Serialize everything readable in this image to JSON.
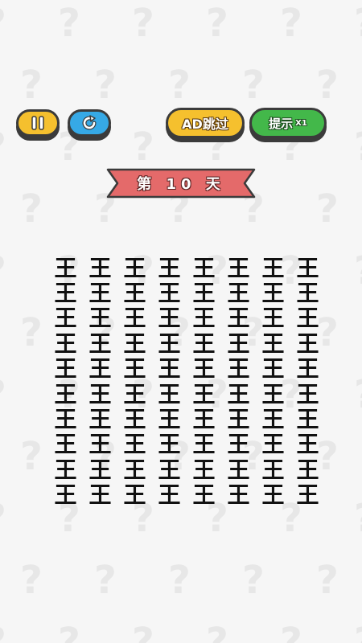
{
  "background": {
    "icon": "question-mark-pattern",
    "glyph": "?"
  },
  "toolbar": {
    "pause_icon": "pause-icon",
    "restart_icon": "restart-icon",
    "skip_label": "AD跳过",
    "hint_label": "提示",
    "hint_count": "X1"
  },
  "level": {
    "label": "第 10 天"
  },
  "grid": {
    "rows": 10,
    "cols": 8,
    "cells": [
      "王",
      "王",
      "王",
      "王",
      "王",
      "王",
      "王",
      "王",
      "王",
      "王",
      "王",
      "王",
      "王",
      "王",
      "王",
      "王",
      "王",
      "王",
      "王",
      "王",
      "王",
      "王",
      "王",
      "王",
      "王",
      "王",
      "王",
      "王",
      "王",
      "王",
      "王",
      "王",
      "王",
      "王",
      "王",
      "王",
      "王",
      "王",
      "王",
      "王",
      "王",
      "王",
      "王",
      "王",
      "王",
      "王",
      "王",
      "王",
      "王",
      "王",
      "王",
      "王",
      "王",
      "王",
      "王",
      "王",
      "王",
      "王",
      "王",
      "王",
      "王",
      "王",
      "王",
      "王",
      "王",
      "王",
      "王",
      "王",
      "王",
      "王",
      "王",
      "王",
      "王",
      "王",
      "王",
      "王",
      "王",
      "王",
      "王",
      "王"
    ]
  },
  "colors": {
    "yellow": "#f5c02e",
    "blue": "#36a9e6",
    "green": "#43b84a",
    "banner_red": "#e46a6a",
    "outline": "#3b3b3b"
  }
}
